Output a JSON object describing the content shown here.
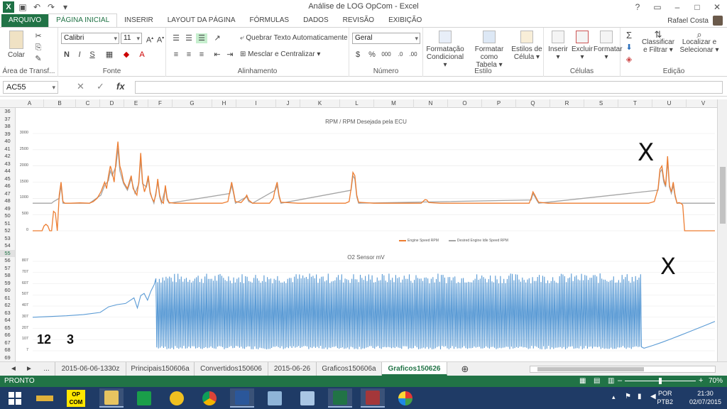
{
  "window": {
    "title": "Análise de LOG OpCom - Excel",
    "app_icon": "X",
    "user": "Rafael Costa"
  },
  "tabs": [
    {
      "label": "ARQUIVO"
    },
    {
      "label": "PÁGINA INICIAL"
    },
    {
      "label": "INSERIR"
    },
    {
      "label": "LAYOUT DA PÁGINA"
    },
    {
      "label": "FÓRMULAS"
    },
    {
      "label": "DADOS"
    },
    {
      "label": "REVISÃO"
    },
    {
      "label": "EXIBIÇÃO"
    }
  ],
  "ribbon": {
    "clipboard": {
      "label": "Área de Transf...",
      "paste": "Colar"
    },
    "font": {
      "label": "Fonte",
      "name": "Calibri",
      "size": "11",
      "bold": "N",
      "italic": "I",
      "underline": "S"
    },
    "alignment": {
      "label": "Alinhamento",
      "wrap": "Quebrar Texto Automaticamente",
      "merge": "Mesclar e Centralizar"
    },
    "number": {
      "label": "Número",
      "format": "Geral",
      "percent": "%",
      "thousands": "000"
    },
    "styles": {
      "label": "Estilo",
      "cond_1": "Formatação",
      "cond_2": "Condicional ▾",
      "table_1": "Formatar como",
      "table_2": "Tabela ▾",
      "cell_1": "Estilos de",
      "cell_2": "Célula ▾"
    },
    "cells": {
      "label": "Células",
      "insert": "Inserir",
      "delete": "Excluir",
      "format": "Formatar"
    },
    "editing": {
      "label": "Edição",
      "sort_1": "Classificar",
      "sort_2": "e Filtrar ▾",
      "find_1": "Localizar e",
      "find_2": "Selecionar ▾"
    }
  },
  "formula_bar": {
    "name_box": "AC55",
    "fx": "fx",
    "value": ""
  },
  "columns": [
    "A",
    "B",
    "C",
    "D",
    "E",
    "F",
    "G",
    "H",
    "I",
    "J",
    "K",
    "L",
    "M",
    "N",
    "O",
    "P",
    "Q",
    "R",
    "S",
    "T",
    "U",
    "V"
  ],
  "rows": [
    "36",
    "37",
    "38",
    "39",
    "40",
    "41",
    "42",
    "43",
    "44",
    "45",
    "46",
    "47",
    "48",
    "49",
    "50",
    "51",
    "52",
    "53",
    "54",
    "55",
    "56",
    "57",
    "58",
    "59",
    "60",
    "61",
    "62",
    "63",
    "64",
    "65",
    "66",
    "67",
    "68",
    "69"
  ],
  "selected_row": "55",
  "chart_data": [
    {
      "type": "line",
      "title": "RPM / RPM Desejada pela ECU",
      "ylim": [
        0,
        3000
      ],
      "yticks": [
        "3000",
        "2500",
        "2000",
        "1500",
        "1000",
        "500",
        "0"
      ],
      "legend": [
        "Engine Speed RPM",
        "Desired Engine Idle Speed RPM"
      ],
      "colors": [
        "#ed7d31",
        "#a5a5a5"
      ],
      "x_count": 300,
      "series": [
        {
          "name": "Engine Speed RPM",
          "points": [
            [
              0,
              0
            ],
            [
              5,
              0
            ],
            [
              6,
              150
            ],
            [
              7,
              200
            ],
            [
              8,
              150
            ],
            [
              9,
              0
            ],
            [
              10,
              0
            ],
            [
              11,
              600
            ],
            [
              12,
              550
            ],
            [
              13,
              0
            ],
            [
              14,
              1100
            ],
            [
              15,
              1500
            ],
            [
              16,
              900
            ],
            [
              17,
              850
            ],
            [
              18,
              850
            ],
            [
              20,
              850
            ],
            [
              25,
              860
            ],
            [
              30,
              850
            ],
            [
              32,
              900
            ],
            [
              34,
              1000
            ],
            [
              36,
              1200
            ],
            [
              38,
              1500
            ],
            [
              39,
              1300
            ],
            [
              40,
              1700
            ],
            [
              41,
              2000
            ],
            [
              42,
              1800
            ],
            [
              43,
              1500
            ],
            [
              44,
              2200
            ],
            [
              45,
              2750
            ],
            [
              46,
              2000
            ],
            [
              47,
              1800
            ],
            [
              48,
              1500
            ],
            [
              49,
              1400
            ],
            [
              50,
              1300
            ],
            [
              51,
              1500
            ],
            [
              52,
              1700
            ],
            [
              53,
              1300
            ],
            [
              54,
              1200
            ],
            [
              55,
              1100
            ],
            [
              56,
              1500
            ],
            [
              57,
              2400
            ],
            [
              58,
              1500
            ],
            [
              59,
              1200
            ],
            [
              60,
              1400
            ],
            [
              61,
              1700
            ],
            [
              62,
              1200
            ],
            [
              63,
              1000
            ],
            [
              64,
              900
            ],
            [
              65,
              1100
            ],
            [
              66,
              1600
            ],
            [
              67,
              1100
            ],
            [
              68,
              900
            ],
            [
              69,
              850
            ],
            [
              70,
              1400
            ],
            [
              71,
              1000
            ],
            [
              72,
              870
            ],
            [
              75,
              850
            ],
            [
              90,
              850
            ],
            [
              100,
              850
            ],
            [
              103,
              900
            ],
            [
              104,
              1200
            ],
            [
              105,
              1500
            ],
            [
              106,
              1200
            ],
            [
              107,
              900
            ],
            [
              110,
              870
            ],
            [
              112,
              1000
            ],
            [
              113,
              1100
            ],
            [
              114,
              950
            ],
            [
              116,
              850
            ],
            [
              125,
              850
            ],
            [
              127,
              1000
            ],
            [
              128,
              1300
            ],
            [
              129,
              1500
            ],
            [
              130,
              1100
            ],
            [
              131,
              880
            ],
            [
              140,
              850
            ],
            [
              160,
              850
            ],
            [
              165,
              850
            ],
            [
              167,
              900
            ],
            [
              168,
              1300
            ],
            [
              169,
              1800
            ],
            [
              170,
              1700
            ],
            [
              171,
              1100
            ],
            [
              172,
              880
            ],
            [
              180,
              850
            ],
            [
              200,
              850
            ],
            [
              205,
              850
            ],
            [
              207,
              960
            ],
            [
              208,
              950
            ],
            [
              209,
              870
            ],
            [
              215,
              850
            ],
            [
              240,
              850
            ],
            [
              262,
              850
            ],
            [
              263,
              1000
            ],
            [
              264,
              1200
            ],
            [
              265,
              1100
            ],
            [
              266,
              980
            ],
            [
              267,
              880
            ],
            [
              272,
              850
            ],
            [
              325,
              850
            ],
            [
              328,
              900
            ],
            [
              330,
              1300
            ],
            [
              331,
              1900
            ],
            [
              332,
              2000
            ],
            [
              333,
              1600
            ],
            [
              334,
              1400
            ],
            [
              335,
              2300
            ],
            [
              336,
              1400
            ],
            [
              337,
              1200
            ],
            [
              338,
              1500
            ],
            [
              339,
              1100
            ],
            [
              340,
              850
            ],
            [
              341,
              870
            ],
            [
              342,
              850
            ],
            [
              343,
              800
            ],
            [
              344,
              0
            ],
            [
              345,
              0
            ],
            [
              360,
              0
            ]
          ]
        },
        {
          "name": "Desired Engine Idle Speed RPM",
          "points": [
            [
              0,
              850
            ],
            [
              10,
              850
            ],
            [
              11,
              900
            ],
            [
              14,
              1000
            ],
            [
              15,
              1400
            ],
            [
              16,
              850
            ],
            [
              30,
              850
            ],
            [
              36,
              1100
            ],
            [
              38,
              1400
            ],
            [
              40,
              1550
            ],
            [
              41,
              1850
            ],
            [
              42,
              1700
            ],
            [
              44,
              2000
            ],
            [
              45,
              2550
            ],
            [
              46,
              1850
            ],
            [
              48,
              1450
            ],
            [
              50,
              1250
            ],
            [
              52,
              1600
            ],
            [
              54,
              1150
            ],
            [
              56,
              1450
            ],
            [
              57,
              2200
            ],
            [
              58,
              1450
            ],
            [
              60,
              1350
            ],
            [
              61,
              1600
            ],
            [
              62,
              1150
            ],
            [
              64,
              850
            ],
            [
              66,
              1500
            ],
            [
              67,
              1050
            ],
            [
              68,
              850
            ],
            [
              70,
              1300
            ],
            [
              71,
              950
            ],
            [
              72,
              850
            ],
            [
              104,
              1150
            ],
            [
              105,
              1400
            ],
            [
              106,
              1150
            ],
            [
              107,
              850
            ],
            [
              113,
              1050
            ],
            [
              114,
              900
            ],
            [
              116,
              850
            ],
            [
              128,
              1250
            ],
            [
              129,
              1400
            ],
            [
              130,
              1050
            ],
            [
              131,
              850
            ],
            [
              168,
              1250
            ],
            [
              169,
              1700
            ],
            [
              170,
              1600
            ],
            [
              171,
              1050
            ],
            [
              172,
              850
            ],
            [
              263,
              950
            ],
            [
              264,
              1150
            ],
            [
              265,
              1050
            ],
            [
              266,
              940
            ],
            [
              267,
              850
            ],
            [
              330,
              1250
            ],
            [
              331,
              1800
            ],
            [
              332,
              1900
            ],
            [
              333,
              1500
            ],
            [
              334,
              1350
            ],
            [
              335,
              2150
            ],
            [
              336,
              1350
            ],
            [
              337,
              1150
            ],
            [
              338,
              1400
            ],
            [
              339,
              1050
            ],
            [
              340,
              850
            ],
            [
              360,
              850
            ]
          ]
        }
      ]
    },
    {
      "type": "line",
      "title": "O2 Sensor mV",
      "ylim": [
        7,
        807
      ],
      "yticks": [
        "807",
        "707",
        "607",
        "507",
        "407",
        "307",
        "207",
        "107",
        "7"
      ],
      "colors": [
        "#5b9bd5"
      ],
      "series": [
        {
          "name": "",
          "start": [
            [
              0,
              307
            ],
            [
              20,
              320
            ],
            [
              30,
              330
            ],
            [
              40,
              350
            ],
            [
              45,
              400
            ],
            [
              50,
              420
            ],
            [
              55,
              430
            ],
            [
              60,
              480
            ],
            [
              62,
              390
            ],
            [
              64,
              500
            ],
            [
              66,
              520
            ],
            [
              68,
              460
            ],
            [
              70,
              540
            ],
            [
              72,
              600
            ]
          ],
          "osc_from": 73,
          "osc_to": 360,
          "osc_high_base": 650,
          "osc_low": 20,
          "tail_start": 362,
          "tail_end": 404,
          "tail_from": 30,
          "tail_to": 270
        }
      ]
    }
  ],
  "annotations": {
    "x1": "X",
    "x2": "X",
    "n12": "12",
    "n3": "3"
  },
  "sheet_tabs": [
    {
      "label": "◄"
    },
    {
      "label": "►"
    },
    {
      "label": "..."
    },
    {
      "label": "2015-06-06-1330z"
    },
    {
      "label": "Principais150606a"
    },
    {
      "label": "Convertidos150606"
    },
    {
      "label": "2015-06-26"
    },
    {
      "label": "Graficos150606a"
    },
    {
      "label": "Graficos150626"
    },
    {
      "label": "⊕"
    }
  ],
  "status": {
    "text": "PRONTO",
    "zoom": "70%"
  },
  "taskbar": {
    "lang_1": "POR",
    "lang_2": "PTB2",
    "time": "21:30",
    "date": "02/07/2015",
    "opcom_1": "OP",
    "opcom_2": "COM"
  }
}
